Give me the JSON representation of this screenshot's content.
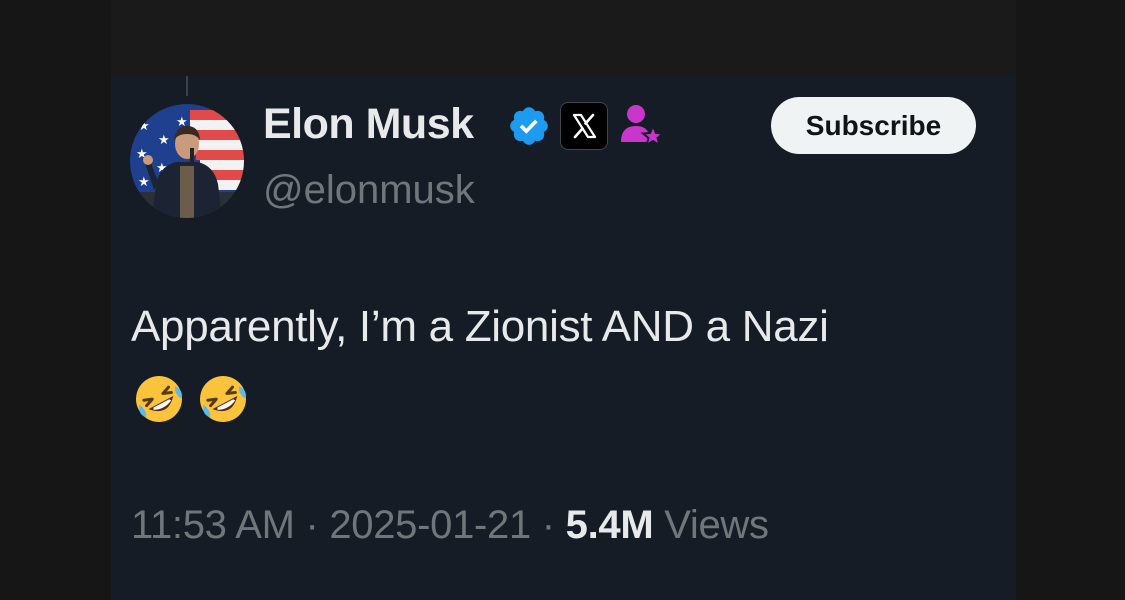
{
  "post": {
    "author": {
      "display_name": "Elon Musk",
      "handle": "@elonmusk",
      "verified_icon": "verified-badge-icon",
      "org_badge_icon": "x-logo-icon",
      "affiliate_icon": "affiliate-person-star-icon"
    },
    "subscribe_label": "Subscribe",
    "text": "Apparently, I’m a Zionist AND a Nazi",
    "emojis": [
      "🤣",
      "🤣"
    ],
    "time": "11:53 AM",
    "separator": "·",
    "date": "2025-01-21",
    "views_count": "5.4M",
    "views_label": "Views"
  },
  "colors": {
    "background": "#151c25",
    "primary_text": "#e7e9ea",
    "secondary_text": "#71767b",
    "verified_blue": "#1d9bf0",
    "affiliate_purple": "#c936cc"
  }
}
